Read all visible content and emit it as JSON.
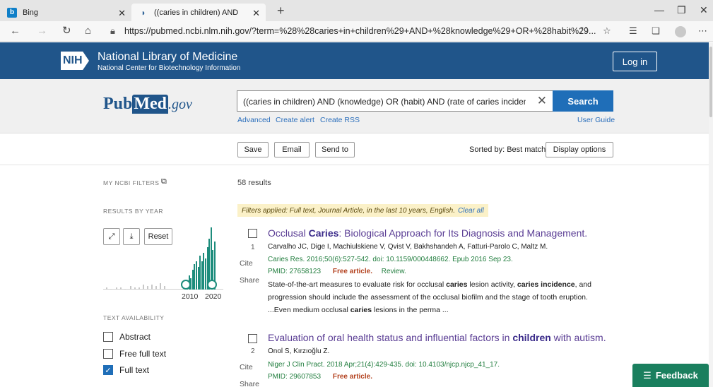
{
  "browser": {
    "tabs": [
      {
        "title": "Bing",
        "icon": "bing-favicon"
      },
      {
        "title": "((caries in children) AND (knowle",
        "icon": "pubmed-favicon"
      }
    ],
    "url": "https://pubmed.ncbi.nlm.nih.gov/?term=%28%28caries+in+children%29+AND+%28knowledge%29+OR+%28habit%29..."
  },
  "nih": {
    "logo": "NIH",
    "title": "National Library of Medicine",
    "subtitle": "National Center for Biotechnology Information",
    "login": "Log in"
  },
  "search": {
    "logo_pub": "Pub",
    "logo_med": "Med",
    "logo_gov": ".gov",
    "query": "((caries in children) AND (knowledge) OR (habit) AND (rate of caries incidence)",
    "button": "Search",
    "advanced": "Advanced",
    "create_alert": "Create alert",
    "create_rss": "Create RSS",
    "user_guide": "User Guide"
  },
  "toolbar": {
    "save": "Save",
    "email": "Email",
    "send_to": "Send to",
    "sorted": "Sorted by: Best match",
    "display_options": "Display options"
  },
  "sidebar": {
    "my_filters": "MY NCBI FILTERS",
    "results_by_year": "RESULTS BY YEAR",
    "reset": "Reset",
    "year_start": "2010",
    "year_end": "2020",
    "text_availability": "TEXT AVAILABILITY",
    "abstract": "Abstract",
    "free_full_text": "Free full text",
    "full_text": "Full text",
    "full_text_checked": true
  },
  "results": {
    "count": "58 results",
    "filters_applied": "Filters applied: Full text, Journal Article, in the last 10 years, English.",
    "clear_all": "Clear all",
    "cite": "Cite",
    "share": "Share",
    "items": [
      {
        "num": "1",
        "title_a": "Occlusal ",
        "title_b": "Caries",
        "title_c": ": Biological Approach for Its Diagnosis and Management.",
        "authors": "Carvalho JC, Dige I, Machiulskiene V, Qvist V, Bakhshandeh A, Fatturi-Parolo C, Maltz M.",
        "journal": "Caries Res. 2016;50(6):527-542. doi: 10.1159/000448662. Epub 2016 Sep 23.",
        "pmid": "PMID: 27658123",
        "free": "Free article.",
        "review": "Review.",
        "snippet1_a": "State-of-the-art measures to evaluate risk for occlusal ",
        "snippet1_b": "caries",
        "snippet1_c": " lesion activity, ",
        "snippet1_d": "caries incidence",
        "snippet1_e": ", and",
        "snippet2": "progression should include the assessment of the occlusal biofilm and the stage of tooth eruption.",
        "snippet3_a": "...Even medium occlusal ",
        "snippet3_b": "caries",
        "snippet3_c": " lesions in the perma ..."
      },
      {
        "num": "2",
        "title_a": "Evaluation of oral health status and influential factors in ",
        "title_b": "children",
        "title_c": " with autism.",
        "authors": "Onol S, Kırzıoğlu Z.",
        "journal": "Niger J Clin Pract. 2018 Apr;21(4):429-435. doi: 10.4103/njcp.njcp_41_17.",
        "pmid": "PMID: 29607853",
        "free": "Free article."
      }
    ]
  },
  "histogram": {
    "years": [
      2000,
      2001,
      2002,
      2003,
      2004,
      2005,
      2006,
      2007,
      2008,
      2009,
      2010,
      2011,
      2012,
      2013,
      2014,
      2015,
      2016,
      2017,
      2018,
      2019,
      2020,
      2021
    ],
    "gray_levels": [
      1,
      0,
      1,
      1,
      0,
      2,
      1,
      1,
      3,
      2,
      3,
      2,
      4,
      2
    ],
    "teal_levels": [
      6,
      10,
      8,
      14,
      18,
      20,
      16,
      24,
      20,
      26,
      22,
      30,
      36,
      44,
      28,
      34
    ]
  },
  "feedback": "Feedback",
  "colors": {
    "nih_blue": "#20558a",
    "search_blue": "#1f6eb8",
    "teal": "#1d8c7c",
    "feedback_green": "#1a7f5e"
  }
}
